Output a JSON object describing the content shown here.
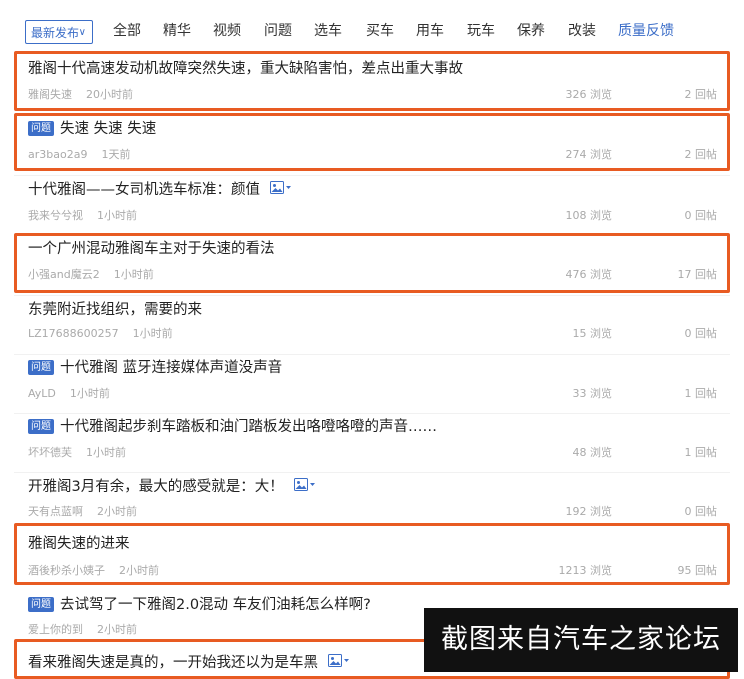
{
  "tabs": {
    "selected": "最新发布",
    "items": [
      "全部",
      "精华",
      "视频",
      "问题",
      "选车",
      "买车",
      "用车",
      "玩车",
      "保养",
      "改装",
      "质量反馈"
    ]
  },
  "badge_text": "问题",
  "views_suffix": "浏览",
  "replies_suffix": "回帖",
  "posts": [
    {
      "title": "雅阁十代高速发动机故障突然失速，重大缺陷害怕，差点出重大事故",
      "author": "雅阁失速",
      "time": "20小时前",
      "views": "326 浏览",
      "replies": "2 回帖",
      "badge": false,
      "image": false,
      "highlight": true
    },
    {
      "title": "失速 失速 失速",
      "author": "ar3bao2a9",
      "time": "1天前",
      "views": "274 浏览",
      "replies": "2 回帖",
      "badge": true,
      "image": false,
      "highlight": true
    },
    {
      "title": "十代雅阁——女司机选车标准：颜值",
      "author": "我来兮兮视",
      "time": "1小时前",
      "views": "108 浏览",
      "replies": "0 回帖",
      "badge": false,
      "image": true,
      "highlight": false
    },
    {
      "title": "一个广州混动雅阁车主对于失速的看法",
      "author": "小强and魔云2",
      "time": "1小时前",
      "views": "476 浏览",
      "replies": "17 回帖",
      "badge": false,
      "image": false,
      "highlight": true
    },
    {
      "title": "东莞附近找组织，需要的来",
      "author": "LZ17688600257",
      "time": "1小时前",
      "views": "15 浏览",
      "replies": "0 回帖",
      "badge": false,
      "image": false,
      "highlight": false
    },
    {
      "title": "十代雅阁 蓝牙连接媒体声道没声音",
      "author": "AyLD",
      "time": "1小时前",
      "views": "33 浏览",
      "replies": "1 回帖",
      "badge": true,
      "image": false,
      "highlight": false
    },
    {
      "title": "十代雅阁起步刹车踏板和油门踏板发出咯噔咯噔的声音……",
      "author": "坏坏德芙",
      "time": "1小时前",
      "views": "48 浏览",
      "replies": "1 回帖",
      "badge": true,
      "image": false,
      "highlight": false
    },
    {
      "title": "开雅阁3月有余，最大的感受就是：大！",
      "author": "天有点蓝啊",
      "time": "2小时前",
      "views": "192 浏览",
      "replies": "0 回帖",
      "badge": false,
      "image": true,
      "highlight": false
    },
    {
      "title": "雅阁失速的进来",
      "author": "酒後秒杀小姨子",
      "time": "2小时前",
      "views": "1213 浏览",
      "replies": "95 回帖",
      "badge": false,
      "image": false,
      "highlight": true
    },
    {
      "title": "去试驾了一下雅阁2.0混动 车友们油耗怎么样啊?",
      "author": "爱上你的到",
      "time": "2小时前",
      "views": "",
      "replies": "",
      "badge": true,
      "image": false,
      "highlight": false
    },
    {
      "title": "看来雅阁失速是真的，一开始我还以为是车黑",
      "author": "",
      "time": "",
      "views": "",
      "replies": "",
      "badge": false,
      "image": true,
      "highlight": true
    }
  ],
  "caption": "截图来自汽车之家论坛",
  "colors": {
    "accent": "#3c6ec8",
    "highlight": "#e85b22"
  }
}
